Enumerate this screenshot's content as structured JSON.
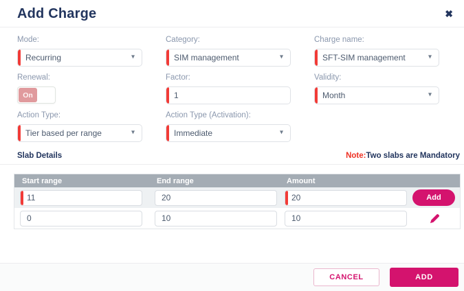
{
  "header": {
    "title": "Add Charge",
    "close_icon": "✖"
  },
  "icons": {
    "select_caret": "▾"
  },
  "form": {
    "mode": {
      "label": "Mode:",
      "value": "Recurring"
    },
    "category": {
      "label": "Category:",
      "value": "SIM management"
    },
    "charge_name": {
      "label": "Charge name:",
      "value": "SFT-SIM management"
    },
    "renewal": {
      "label": "Renewal:",
      "state": "On"
    },
    "factor": {
      "label": "Factor:",
      "value": "1"
    },
    "validity": {
      "label": "Validity:",
      "value": "Month"
    },
    "action_type": {
      "label": "Action Type:",
      "value": "Tier based per range"
    },
    "action_type_activation": {
      "label": "Action Type (Activation):",
      "value": "Immediate"
    }
  },
  "slab": {
    "title": "Slab Details",
    "note_label": "Note:",
    "note_text": "Two slabs are Mandatory",
    "headers": [
      "Start range",
      "End range",
      "Amount"
    ],
    "rows": [
      {
        "start": "11",
        "end": "20",
        "amount": "20"
      },
      {
        "start": "0",
        "end": "10",
        "amount": "10"
      }
    ],
    "add_row_label": "Add"
  },
  "footer": {
    "cancel_label": "CANCEL",
    "add_label": "ADD"
  },
  "colors": {
    "accent_magenta": "#d4136e",
    "required_red": "#f23b37",
    "title_navy": "#22355e",
    "label_gray": "#8a97ad",
    "table_header_bg": "#a4acb4",
    "toggle_on_pink": "#e09a9d"
  }
}
